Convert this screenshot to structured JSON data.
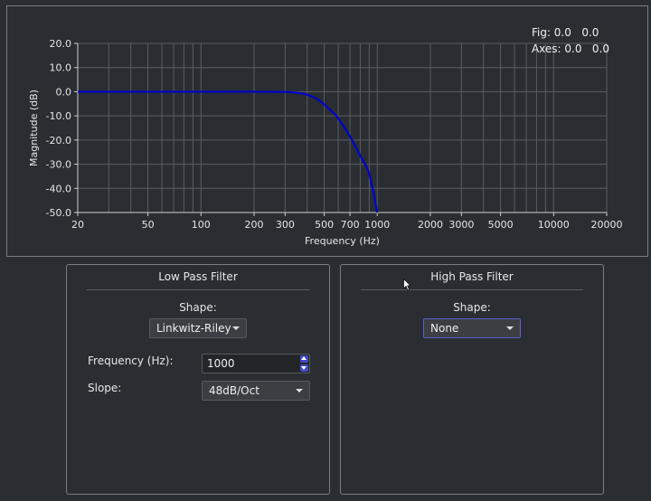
{
  "plot": {
    "coord_fig": "Fig: 0.0   0.0",
    "coord_axes": "Axes: 0.0   0.0",
    "colors": {
      "curve": "#0000cc",
      "grid": "#5a5e62",
      "axis": "#cccccc"
    }
  },
  "chart_data": {
    "type": "line",
    "title": "",
    "xlabel": "Frequency (Hz)",
    "ylabel": "Magnitude (dB)",
    "xscale": "log",
    "xlim": [
      20,
      20000
    ],
    "ylim": [
      -50,
      20
    ],
    "x_ticks": [
      20,
      50,
      100,
      200,
      300,
      500,
      700,
      1000,
      2000,
      3000,
      5000,
      10000,
      20000
    ],
    "x_tick_labels": [
      "20",
      "50",
      "100",
      "200",
      "300",
      "500",
      "700",
      "1000",
      "2000",
      "3000",
      "5000",
      "10000",
      "20000"
    ],
    "y_ticks": [
      20,
      10,
      0,
      -10,
      -20,
      -30,
      -40,
      -50
    ],
    "y_tick_labels": [
      "20.0",
      "10.0",
      "0.0",
      "-10.0",
      "-20.0",
      "-30.0",
      "-40.0",
      "-50.0"
    ],
    "grid": true,
    "series": [
      {
        "x": [
          20,
          100,
          200,
          300,
          350,
          400,
          450,
          500,
          550,
          600,
          700,
          800,
          900,
          1000
        ],
        "y": [
          0,
          0,
          0,
          -0.1,
          -0.4,
          -1.2,
          -2.8,
          -5.2,
          -8.0,
          -11.0,
          -18.5,
          -26.5,
          -34.0,
          -50.0
        ]
      }
    ]
  },
  "lowpass": {
    "title": "Low Pass Filter",
    "shape_label": "Shape:",
    "shape_value": "Linkwitz-Riley",
    "frequency_label": "Frequency (Hz):",
    "frequency_value": "1000",
    "slope_label": "Slope:",
    "slope_value": "48dB/Oct"
  },
  "highpass": {
    "title": "High Pass Filter",
    "shape_label": "Shape:",
    "shape_value": "None"
  }
}
